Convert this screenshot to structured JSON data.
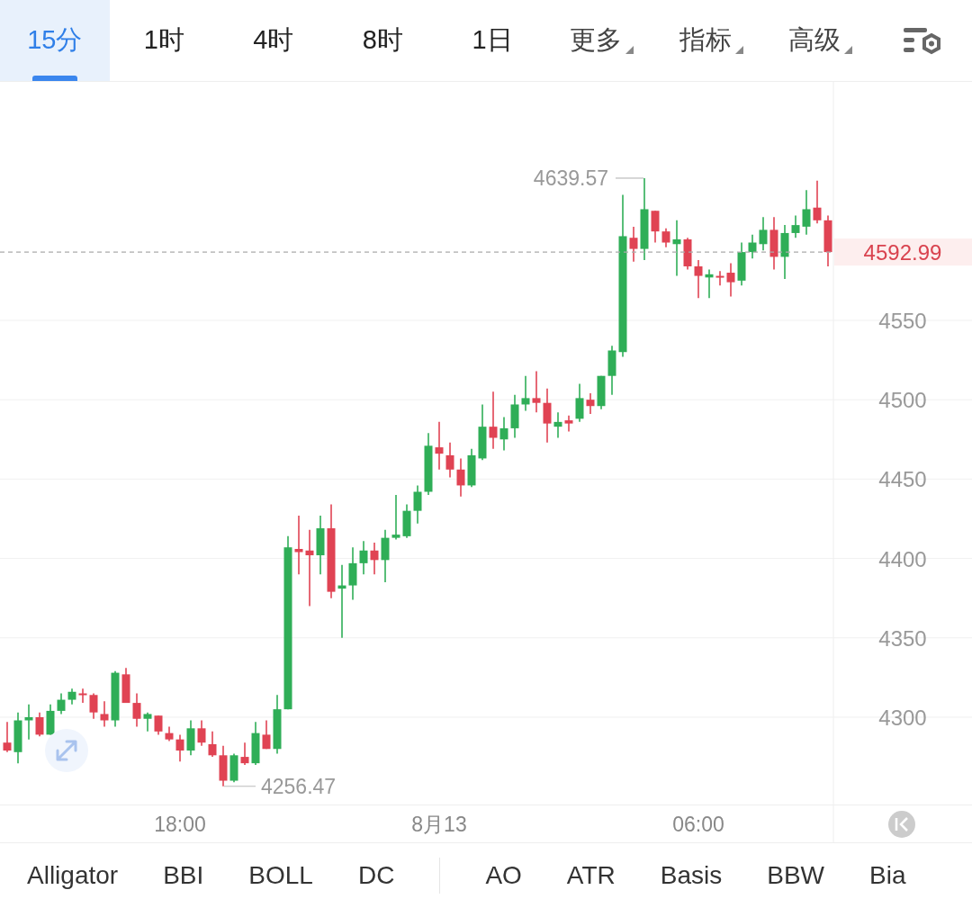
{
  "timeframe_tabs": [
    {
      "label": "15分",
      "selected": true,
      "kind": "tab"
    },
    {
      "label": "1时",
      "selected": false,
      "kind": "tab"
    },
    {
      "label": "4时",
      "selected": false,
      "kind": "tab"
    },
    {
      "label": "8时",
      "selected": false,
      "kind": "tab"
    },
    {
      "label": "1日",
      "selected": false,
      "kind": "tab"
    },
    {
      "label": "更多",
      "selected": false,
      "kind": "dropdown"
    },
    {
      "label": "指标",
      "selected": false,
      "kind": "dropdown"
    },
    {
      "label": "高级",
      "selected": false,
      "kind": "dropdown"
    }
  ],
  "chart": {
    "chart_data": {
      "type": "candlestick",
      "grid": true,
      "ylim": [
        4245,
        4700.2
      ],
      "yticks": [
        4300,
        4350,
        4400,
        4450,
        4500,
        4550
      ],
      "categories": [
        null,
        null,
        null,
        null,
        null,
        null,
        null,
        null,
        null,
        null,
        null,
        null,
        null,
        null,
        null,
        null,
        "18:00",
        null,
        null,
        null,
        null,
        null,
        null,
        null,
        null,
        null,
        null,
        null,
        null,
        null,
        null,
        null,
        null,
        null,
        null,
        null,
        null,
        null,
        null,
        null,
        "8月13",
        null,
        null,
        null,
        null,
        null,
        null,
        null,
        null,
        null,
        null,
        null,
        null,
        null,
        null,
        null,
        null,
        null,
        null,
        null,
        null,
        null,
        null,
        null,
        "06:00",
        null,
        null,
        null,
        null,
        null,
        null,
        null,
        null,
        null,
        null,
        null,
        null
      ],
      "ohlc": [
        [
          4284,
          4297,
          4278,
          4279
        ],
        [
          4278,
          4303,
          4271,
          4298
        ],
        [
          4298,
          4308,
          4286,
          4300
        ],
        [
          4300,
          4303,
          4288,
          4289
        ],
        [
          4289,
          4308,
          4289,
          4304
        ],
        [
          4304,
          4315,
          4302,
          4311
        ],
        [
          4311,
          4318,
          4308,
          4316
        ],
        [
          4315,
          4318,
          4309,
          4314
        ],
        [
          4314,
          4315,
          4299,
          4303
        ],
        [
          4302,
          4310,
          4294,
          4298
        ],
        [
          4298,
          4329,
          4294,
          4328
        ],
        [
          4327,
          4331,
          4309,
          4309
        ],
        [
          4309,
          4315,
          4294,
          4299
        ],
        [
          4299,
          4303,
          4291,
          4302
        ],
        [
          4301,
          4301,
          4289,
          4291
        ],
        [
          4290,
          4294,
          4285,
          4286
        ],
        [
          4286,
          4289,
          4272,
          4279
        ],
        [
          4279,
          4298,
          4276,
          4293
        ],
        [
          4293,
          4298,
          4282,
          4284
        ],
        [
          4283,
          4291,
          4275,
          4276
        ],
        [
          4276,
          4282,
          4256.47,
          4260
        ],
        [
          4260,
          4277,
          4259,
          4276
        ],
        [
          4275,
          4284,
          4270,
          4271
        ],
        [
          4271,
          4297,
          4270,
          4290
        ],
        [
          4289,
          4298,
          4280,
          4280
        ],
        [
          4280,
          4314,
          4277,
          4305
        ],
        [
          4305,
          4414,
          4305,
          4407
        ],
        [
          4406,
          4427,
          4390,
          4404
        ],
        [
          4405,
          4418,
          4370,
          4402
        ],
        [
          4402,
          4427,
          4390,
          4419
        ],
        [
          4419,
          4434,
          4375,
          4379
        ],
        [
          4381,
          4396,
          4350,
          4383
        ],
        [
          4383,
          4407,
          4374,
          4397
        ],
        [
          4397,
          4411,
          4390,
          4405
        ],
        [
          4405,
          4410,
          4390,
          4399
        ],
        [
          4399,
          4418,
          4385,
          4413
        ],
        [
          4413,
          4440,
          4412,
          4415
        ],
        [
          4414,
          4434,
          4413,
          4430
        ],
        [
          4430,
          4446,
          4422,
          4442
        ],
        [
          4442,
          4479,
          4440,
          4471
        ],
        [
          4470,
          4486,
          4456,
          4466
        ],
        [
          4465,
          4473,
          4451,
          4456
        ],
        [
          4456,
          4463,
          4439,
          4446
        ],
        [
          4446,
          4469,
          4445,
          4465
        ],
        [
          4463,
          4497,
          4462,
          4483
        ],
        [
          4483,
          4505,
          4469,
          4476
        ],
        [
          4475,
          4489,
          4468,
          4482
        ],
        [
          4482,
          4503,
          4476,
          4497
        ],
        [
          4497,
          4515,
          4493,
          4501
        ],
        [
          4501,
          4518,
          4492,
          4498
        ],
        [
          4498,
          4507,
          4473,
          4485
        ],
        [
          4483,
          4492,
          4476,
          4486
        ],
        [
          4487,
          4490,
          4480,
          4485
        ],
        [
          4488,
          4510,
          4486,
          4501
        ],
        [
          4500,
          4504,
          4491,
          4496
        ],
        [
          4496,
          4515,
          4494,
          4515
        ],
        [
          4515,
          4534,
          4503,
          4531
        ],
        [
          4530,
          4629,
          4527,
          4603
        ],
        [
          4602,
          4609,
          4587,
          4595
        ],
        [
          4595,
          4639.57,
          4588,
          4620
        ],
        [
          4619,
          4619,
          4599,
          4606
        ],
        [
          4606,
          4608,
          4596,
          4599
        ],
        [
          4598,
          4613,
          4578,
          4601
        ],
        [
          4601,
          4602,
          4582,
          4584
        ],
        [
          4584,
          4588,
          4564,
          4578
        ],
        [
          4577,
          4582,
          4564,
          4579
        ],
        [
          4578,
          4581,
          4572,
          4577
        ],
        [
          4580,
          4586,
          4565,
          4574
        ],
        [
          4575,
          4599,
          4572,
          4593
        ],
        [
          4593,
          4604,
          4589,
          4599
        ],
        [
          4598,
          4615,
          4594,
          4607
        ],
        [
          4607,
          4615,
          4582,
          4590
        ],
        [
          4590,
          4610,
          4576,
          4605
        ],
        [
          4605,
          4616,
          4602,
          4610
        ],
        [
          4609,
          4632,
          4604,
          4620
        ],
        [
          4621,
          4638,
          4611,
          4613
        ],
        [
          4613,
          4616,
          4584,
          4592.99
        ]
      ],
      "annotations": [
        "4639.57",
        "4256.47"
      ],
      "ref_lines": [
        {
          "axis": "y",
          "value": 4592.99,
          "label": "4592.99"
        }
      ]
    }
  },
  "indicators": {
    "main": [
      "Alligator",
      "BBI",
      "BOLL",
      "DC"
    ],
    "sub": [
      "AO",
      "ATR",
      "Basis",
      "BBW",
      "Bia"
    ]
  }
}
